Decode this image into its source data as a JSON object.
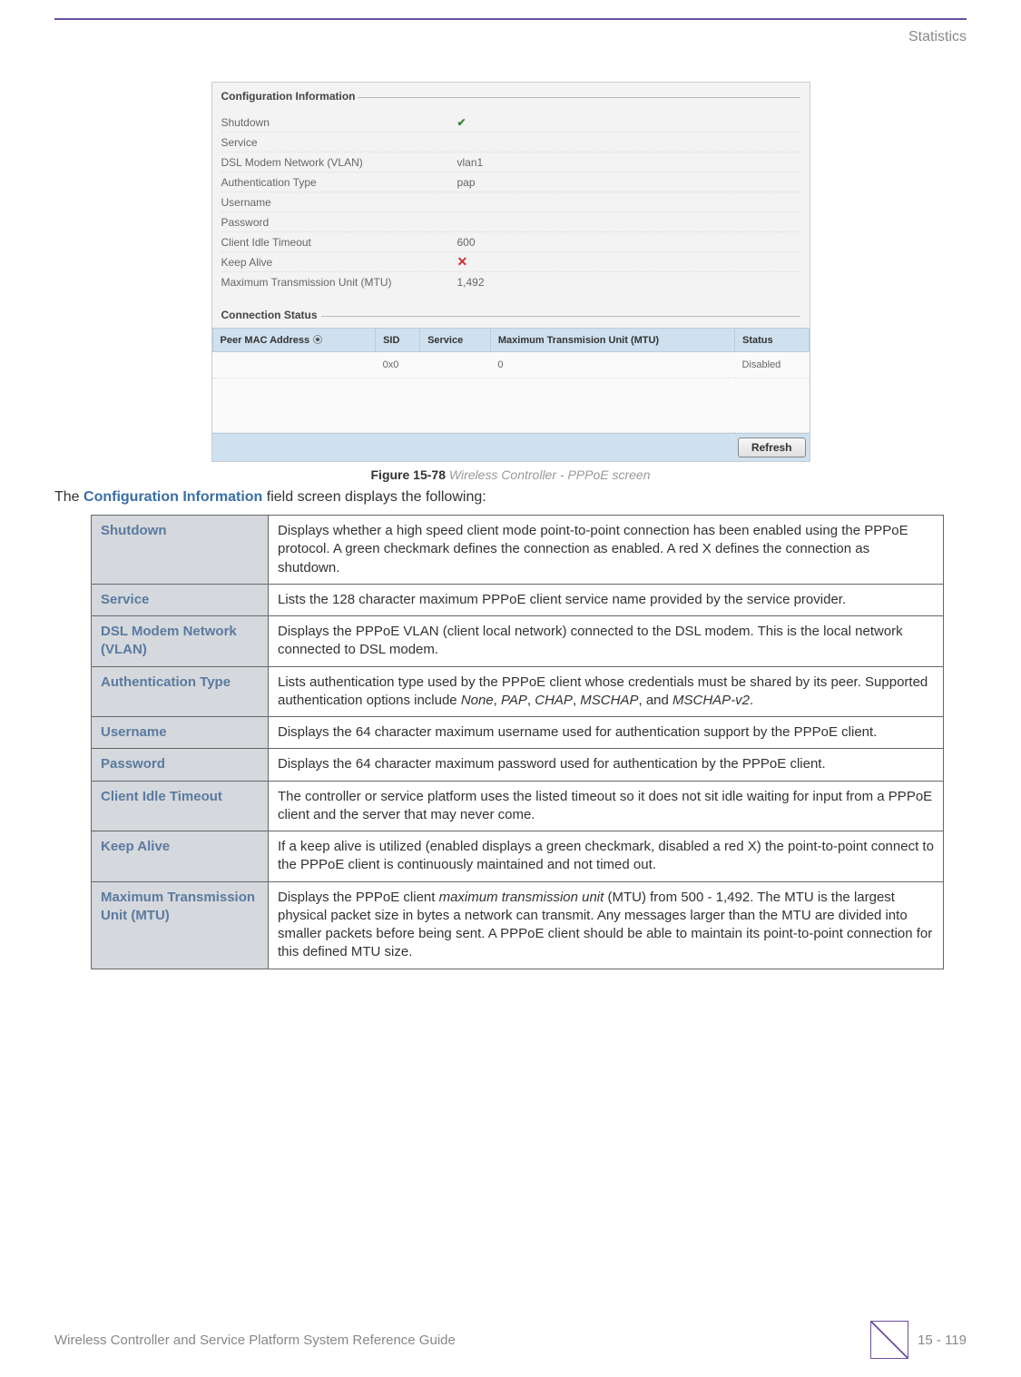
{
  "header": {
    "section": "Statistics"
  },
  "screenshot": {
    "config_info": {
      "title": "Configuration Information",
      "rows": [
        {
          "label": "Shutdown",
          "value_type": "check"
        },
        {
          "label": "Service",
          "value": ""
        },
        {
          "label": "DSL Modem Network (VLAN)",
          "value": "vlan1"
        },
        {
          "label": "Authentication Type",
          "value": "pap"
        },
        {
          "label": "Username",
          "value": ""
        },
        {
          "label": "Password",
          "value": ""
        },
        {
          "label": "Client Idle Timeout",
          "value": "600"
        },
        {
          "label": "Keep Alive",
          "value_type": "x"
        },
        {
          "label": "Maximum Transmission Unit (MTU)",
          "value": "1,492"
        }
      ]
    },
    "connection_status": {
      "title": "Connection Status",
      "columns": [
        "Peer MAC Address",
        "SID",
        "Service",
        "Maximum Transmision Unit (MTU)",
        "Status"
      ],
      "rows": [
        {
          "peer": "",
          "sid": "0x0",
          "service": "",
          "mtu": "0",
          "status": "Disabled"
        }
      ]
    },
    "refresh_label": "Refresh"
  },
  "figure": {
    "number": "Figure 15-78",
    "text": "Wireless Controller - PPPoE screen"
  },
  "intro": {
    "prefix": "The ",
    "highlight": "Configuration Information",
    "suffix": " field screen displays the following:"
  },
  "desc_rows": [
    {
      "term": "Shutdown",
      "desc": "Displays whether a high speed client mode point-to-point connection has been enabled using the PPPoE protocol. A green checkmark defines the connection as enabled. A red X defines the connection as shutdown."
    },
    {
      "term": "Service",
      "desc": "Lists the 128 character maximum PPPoE client service name provided by the service provider."
    },
    {
      "term": "DSL Modem Network (VLAN)",
      "desc": "Displays the PPPoE VLAN (client local network) connected to the DSL modem. This is the local network connected to DSL modem."
    },
    {
      "term": "Authentication Type",
      "desc_html": "Lists authentication type used by the PPPoE client whose credentials must be shared by its peer. Supported authentication options include <em>None</em>, <em>PAP</em>, <em>CHAP</em>, <em>MSCHAP</em>, and <em>MSCHAP-v2</em>."
    },
    {
      "term": "Username",
      "desc": "Displays the 64 character maximum username used for authentication support by the PPPoE client."
    },
    {
      "term": "Password",
      "desc": "Displays the 64 character maximum password used for authentication by the PPPoE client."
    },
    {
      "term": "Client Idle Timeout",
      "desc": "The controller or service platform uses the listed timeout so it does not sit idle waiting for input from a PPPoE client and the server that may never come."
    },
    {
      "term": "Keep Alive",
      "desc": "If a keep alive is utilized (enabled displays a green checkmark, disabled a red X) the point-to-point connect to the PPPoE client is continuously maintained and not timed out."
    },
    {
      "term": "Maximum Transmission Unit (MTU)",
      "desc_html": "Displays the PPPoE client <em>maximum transmission unit</em> (MTU) from 500 - 1,492. The MTU is the largest physical packet size in bytes a network can transmit. Any messages larger than the MTU are divided into smaller packets before being sent. A PPPoE client should be able to maintain its point-to-point connection for this defined MTU size."
    }
  ],
  "footer": {
    "title": "Wireless Controller and Service Platform System Reference Guide",
    "page": "15 - 119"
  }
}
